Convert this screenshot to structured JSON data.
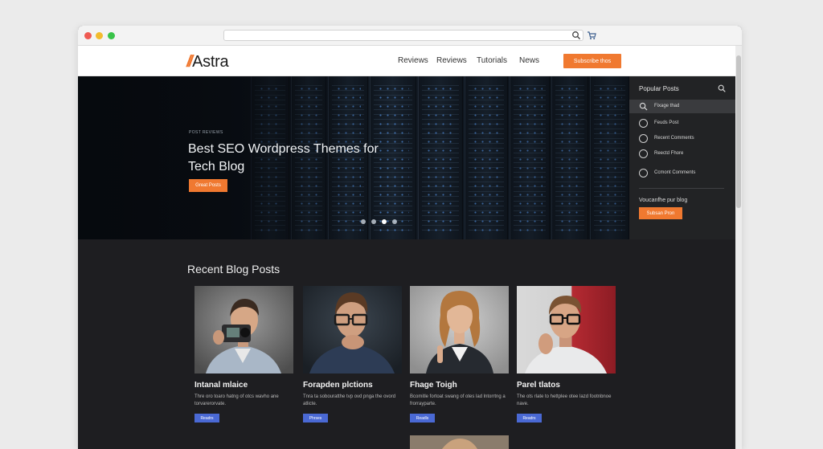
{
  "site": {
    "logo_mark": "//",
    "logo_text": "Astra",
    "nav": [
      "Reviews",
      "Reviews",
      "Tutorials",
      "News"
    ],
    "subscribe_label": "Subscribe thos"
  },
  "hero": {
    "kicker": "POST REVIEWS",
    "title": "Best SEO Wordpress Themes for Tech Blog",
    "button_label": "Great Posts",
    "slide_count": 4,
    "active_slide": 3
  },
  "sidebar": {
    "title": "Popular Posts",
    "items": [
      {
        "label": "Fixage thad",
        "icon": "search-icon"
      },
      {
        "label": "Feuds Post",
        "icon": "clock-icon"
      },
      {
        "label": "Recent Comments",
        "icon": "clock-icon"
      },
      {
        "label": "Reectd Fhore",
        "icon": "clock-icon"
      },
      {
        "label": "Ccmont Comments",
        "icon": "clock-icon"
      }
    ],
    "subscribe_heading": "Voucanfhe pur blog",
    "subscribe_button": "Subsan Pron"
  },
  "content": {
    "section_title": "Recent Blog Posts",
    "posts": [
      {
        "title": "Intanal mlaice",
        "excerpt": "Thre oro toaro hatng of otcs wavho ane torvarerorvate.",
        "button": "Readrs"
      },
      {
        "title": "Forapden plctions",
        "excerpt": "Tnra ta sobouratthe tvp ovd pnga the ovord atlicte.",
        "button": "Phrses"
      },
      {
        "title": "Fhage Toigh",
        "excerpt": "Bcomitle fortoat swang of otes lad lntorrtng a frorrayparte.",
        "button": "Readls"
      },
      {
        "title": "Parel tlatos",
        "excerpt": "The ots rlate to hettplee otee lazd footnbnoe nave.",
        "button": "Readrs"
      }
    ]
  },
  "colors": {
    "accent": "#f07930",
    "card_button": "#4a69d4",
    "page_bg": "#1e1e21",
    "sidebar_bg": "#222325"
  }
}
